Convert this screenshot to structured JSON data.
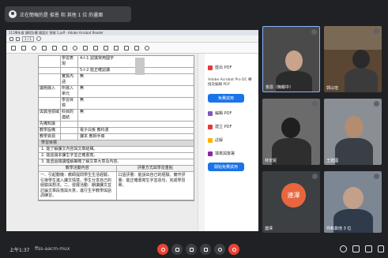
{
  "presenter": {
    "label": "正在簡報的是 俊恩 和 其他 1 位 的畫面"
  },
  "window": {
    "title": "111學年度 課程計畫 國語文 領域 1.pdf - Adobe Acrobat Reader"
  },
  "pdf": {
    "page_field": "1 / 1"
  },
  "document": {
    "rows": [
      {
        "c1": "",
        "c2": "學習表現",
        "c3": "4-I-1 認識常用國字"
      },
      {
        "c1": "",
        "c2": "",
        "c3": "5-I-2 能正確認讀"
      },
      {
        "c1": "",
        "c2": "實質內涵",
        "c3": "無"
      },
      {
        "c1": "議題融入",
        "c2": "所融入單元",
        "c3": "無"
      },
      {
        "c1": "",
        "c2": "學習目標",
        "c3": "無"
      },
      {
        "c1": "與其他領域",
        "c2": "科目的連結",
        "c3": "無"
      },
      {
        "c1": "先備知識",
        "c2": "",
        "c3": ""
      },
      {
        "c1": "教學設備",
        "c2": "",
        "c3": "電子白板 教科書"
      },
      {
        "c1": "教學資源",
        "c2": "",
        "c3": "課本 教師手冊"
      }
    ],
    "objectives_header": "學習目標",
    "objectives": [
      "1. 能了解課文內容與文章結構。",
      "2. 能認識本課生字並正確書寫。",
      "3. 能透過閱讀理解策略了解文章大意及內容。"
    ],
    "table_headers": {
      "left": "教學活動內容",
      "right": "評量方式與學習重點"
    },
    "paragraphs": {
      "left": "一、引起動機：教師提問學生生活經驗，引導學生進入課文情境，學生分享自己的經驗與想法。二、發展活動：朗讀課文並討論文章段落與大意，進行生字教學與語詞練習。",
      "right": "口語評量：能說出自己的經驗。實作評量：能正確書寫生字並造句，完成學習單。"
    }
  },
  "side_panel": {
    "items": [
      {
        "label": "匯出 PDF",
        "color": "#e53935"
      },
      {
        "label": "編輯 PDF",
        "color": "#7e57c2"
      },
      {
        "label": "建立 PDF",
        "color": "#e53935"
      },
      {
        "label": "註解",
        "color": "#ffb300"
      },
      {
        "label": "填寫與簽署",
        "color": "#8e24aa"
      }
    ],
    "promo_text": "Adobe Acrobat Pro DC 轉換及編輯 PDF",
    "try_button": "免費試用",
    "trial_button": "開始免費試用"
  },
  "participants": [
    {
      "name": "俊恩（簡報中）",
      "type": "video"
    },
    {
      "name": "郭以瑄",
      "type": "video"
    },
    {
      "name": "林安妮",
      "type": "video"
    },
    {
      "name": "王建國",
      "type": "video"
    },
    {
      "name": "連澤",
      "type": "avatar",
      "initials": "連澤"
    },
    {
      "name": "你和其他 3 位",
      "type": "video"
    }
  ],
  "meeting": {
    "time": "上午1:37",
    "code": "ffss-aacm-mux"
  },
  "colors": {
    "end_call": "#ea4335",
    "avatar": "#e8663d",
    "accent": "#1a73e8"
  }
}
